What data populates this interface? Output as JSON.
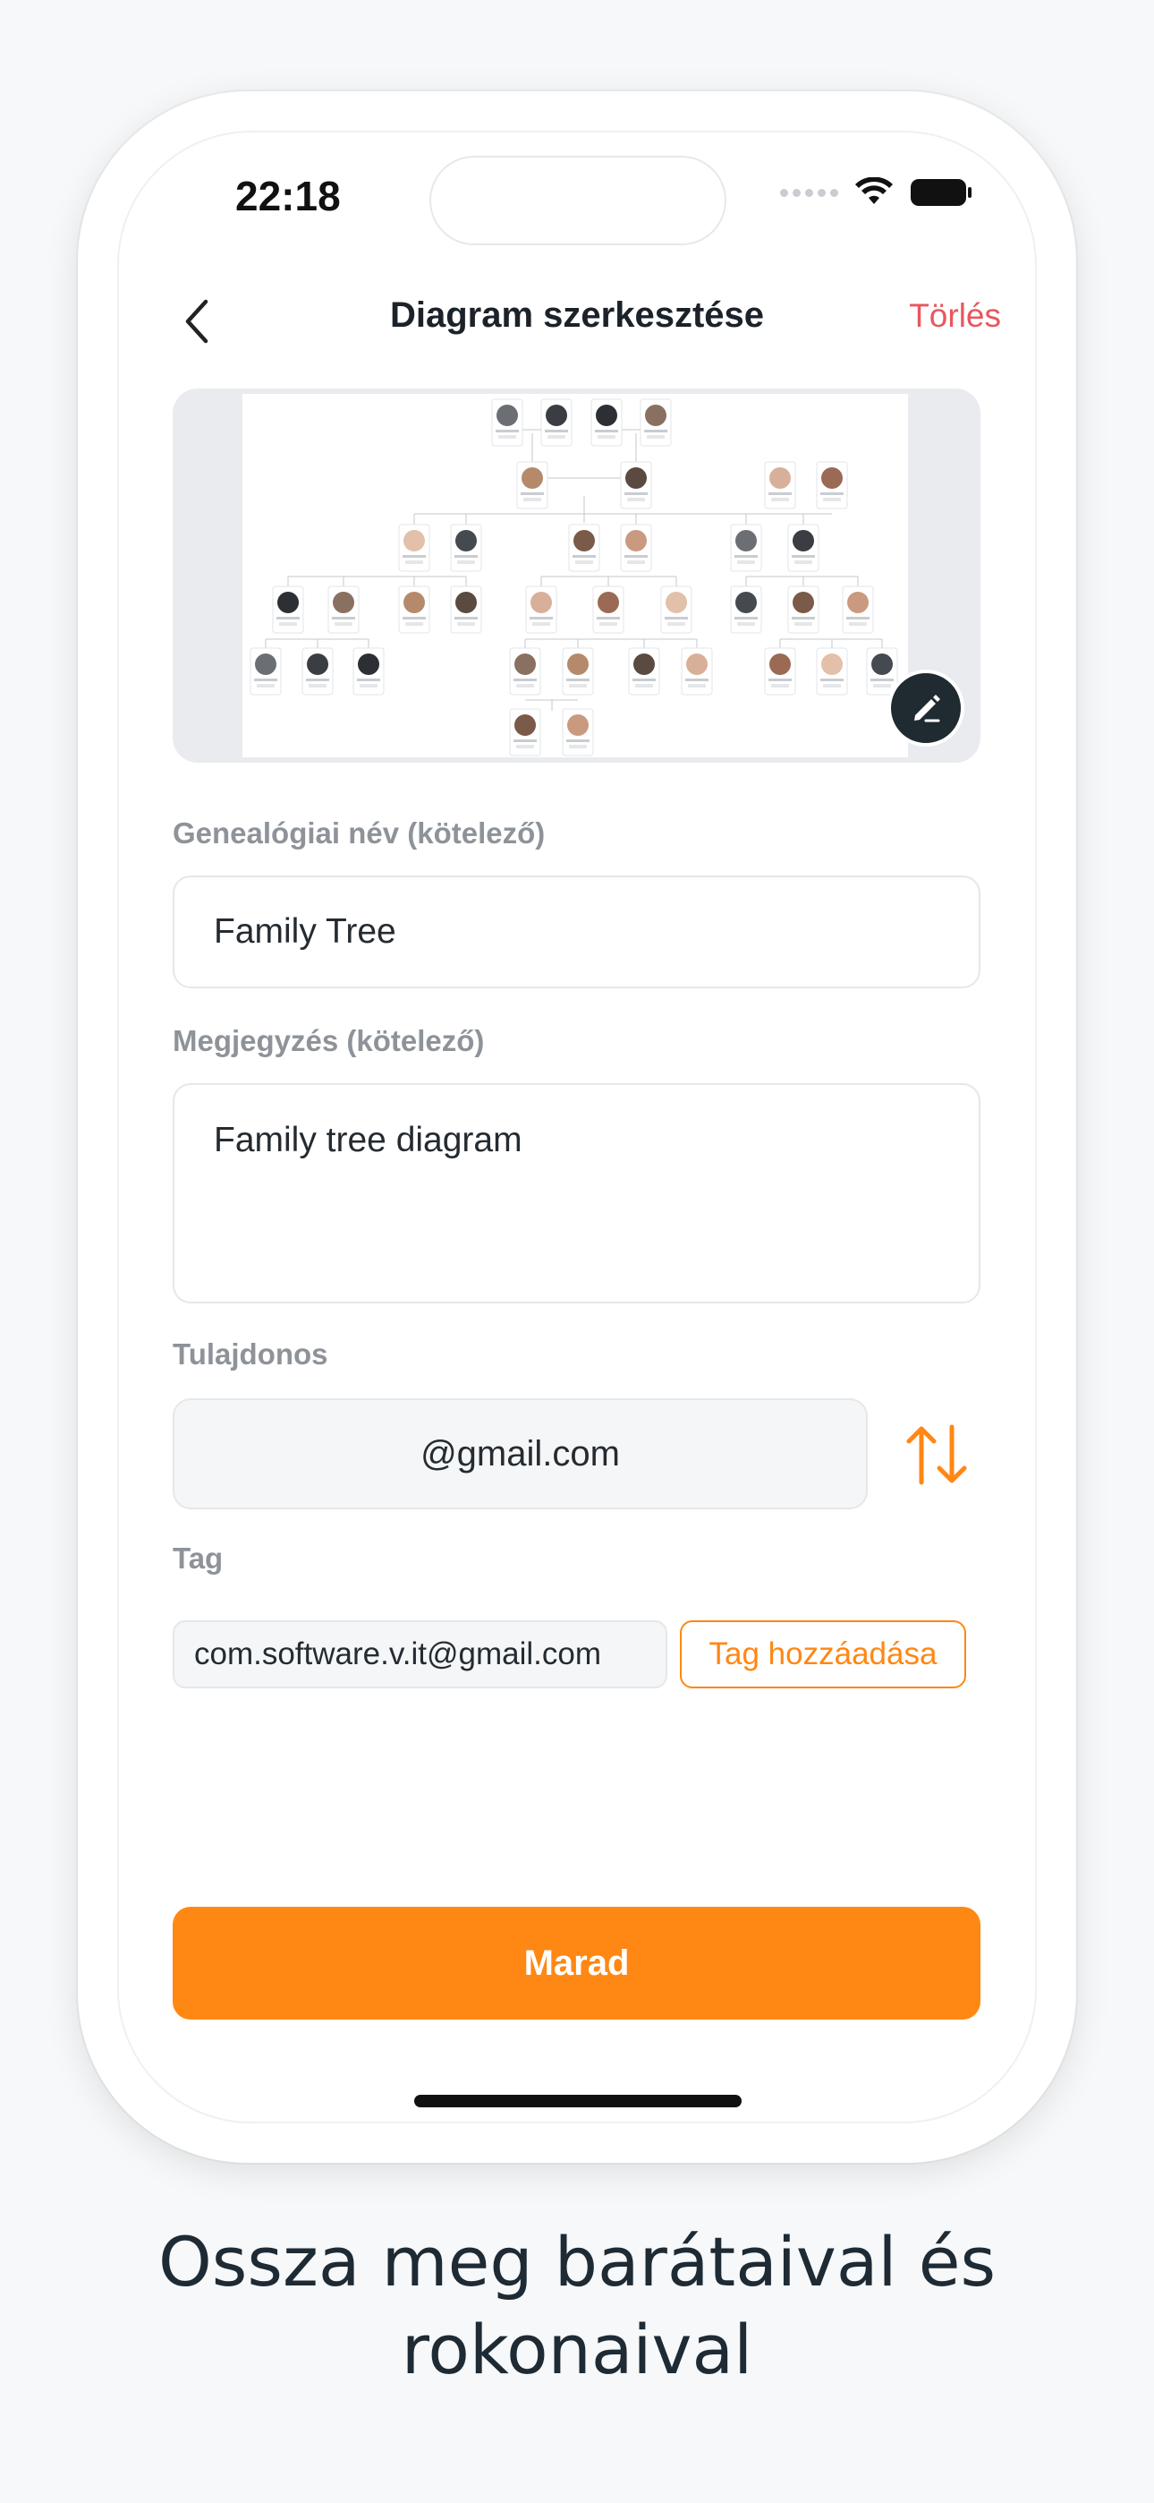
{
  "status_bar": {
    "time": "22:18"
  },
  "nav": {
    "title": "Diagram szerkesztése",
    "delete_label": "Törlés"
  },
  "form": {
    "name_label": "Genealógiai név (kötelező)",
    "name_value": "Family Tree",
    "note_label": "Megjegyzés (kötelező)",
    "note_value": "Family tree diagram",
    "owner_label": "Tulajdonos",
    "owner_value": "@gmail.com",
    "tag_label": "Tag",
    "tag_value": "com.software.v.it@gmail.com",
    "tag_add_label": "Tag hozzáadása",
    "submit_label": "Marad"
  },
  "caption": {
    "line1": "Ossza meg barátaival és",
    "line2": "rokonaival"
  },
  "colors": {
    "accent": "#ff8713",
    "danger": "#e8565f",
    "dark": "#1f2a31"
  },
  "icons": {
    "back": "chevron-left-icon",
    "edit": "pencil-icon",
    "swap": "swap-vertical-icon"
  }
}
